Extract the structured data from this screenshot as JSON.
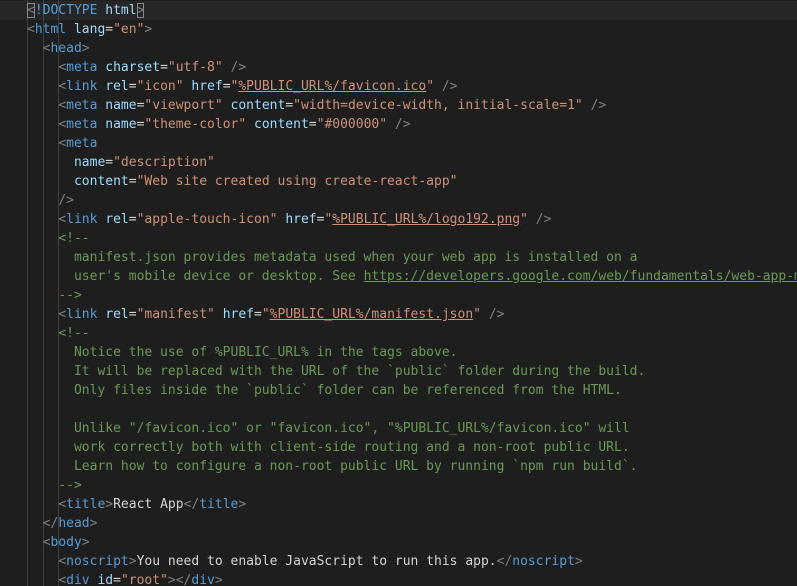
{
  "editor": {
    "colors": {
      "background": "#1e1e1e",
      "tag": "#569cd6",
      "attribute": "#9cdcfe",
      "string": "#ce9178",
      "comment": "#6a9955",
      "punctuation": "#808080",
      "text": "#d4d4d4"
    },
    "lines": [
      {
        "indent": 0,
        "active": true,
        "tokens": [
          {
            "c": "punct",
            "t": "<",
            "bracket": true
          },
          {
            "c": "tag",
            "t": "!DOCTYPE"
          },
          {
            "c": "text",
            "t": " "
          },
          {
            "c": "attr",
            "t": "html"
          },
          {
            "c": "punct",
            "t": ">",
            "bracket": true
          }
        ]
      },
      {
        "indent": 0,
        "tokens": [
          {
            "c": "punct",
            "t": "<"
          },
          {
            "c": "tag",
            "t": "html"
          },
          {
            "c": "text",
            "t": " "
          },
          {
            "c": "attr",
            "t": "lang"
          },
          {
            "c": "text",
            "t": "="
          },
          {
            "c": "str",
            "t": "\"en\""
          },
          {
            "c": "punct",
            "t": ">"
          }
        ]
      },
      {
        "indent": 2,
        "tokens": [
          {
            "c": "punct",
            "t": "<"
          },
          {
            "c": "tag",
            "t": "head"
          },
          {
            "c": "punct",
            "t": ">"
          }
        ]
      },
      {
        "indent": 4,
        "tokens": [
          {
            "c": "punct",
            "t": "<"
          },
          {
            "c": "tag",
            "t": "meta"
          },
          {
            "c": "text",
            "t": " "
          },
          {
            "c": "attr",
            "t": "charset"
          },
          {
            "c": "text",
            "t": "="
          },
          {
            "c": "str",
            "t": "\"utf-8\""
          },
          {
            "c": "text",
            "t": " "
          },
          {
            "c": "punct",
            "t": "/>"
          }
        ]
      },
      {
        "indent": 4,
        "tokens": [
          {
            "c": "punct",
            "t": "<"
          },
          {
            "c": "tag",
            "t": "link"
          },
          {
            "c": "text",
            "t": " "
          },
          {
            "c": "attr",
            "t": "rel"
          },
          {
            "c": "text",
            "t": "="
          },
          {
            "c": "str",
            "t": "\"icon\""
          },
          {
            "c": "text",
            "t": " "
          },
          {
            "c": "attr",
            "t": "href"
          },
          {
            "c": "text",
            "t": "="
          },
          {
            "c": "str",
            "t": "\""
          },
          {
            "c": "str",
            "t": "%PUBLIC_URL%/favicon.ico",
            "link": true
          },
          {
            "c": "str",
            "t": "\""
          },
          {
            "c": "text",
            "t": " "
          },
          {
            "c": "punct",
            "t": "/>"
          }
        ]
      },
      {
        "indent": 4,
        "tokens": [
          {
            "c": "punct",
            "t": "<"
          },
          {
            "c": "tag",
            "t": "meta"
          },
          {
            "c": "text",
            "t": " "
          },
          {
            "c": "attr",
            "t": "name"
          },
          {
            "c": "text",
            "t": "="
          },
          {
            "c": "str",
            "t": "\"viewport\""
          },
          {
            "c": "text",
            "t": " "
          },
          {
            "c": "attr",
            "t": "content"
          },
          {
            "c": "text",
            "t": "="
          },
          {
            "c": "str",
            "t": "\"width=device-width, initial-scale=1\""
          },
          {
            "c": "text",
            "t": " "
          },
          {
            "c": "punct",
            "t": "/>"
          }
        ]
      },
      {
        "indent": 4,
        "tokens": [
          {
            "c": "punct",
            "t": "<"
          },
          {
            "c": "tag",
            "t": "meta"
          },
          {
            "c": "text",
            "t": " "
          },
          {
            "c": "attr",
            "t": "name"
          },
          {
            "c": "text",
            "t": "="
          },
          {
            "c": "str",
            "t": "\"theme-color\""
          },
          {
            "c": "text",
            "t": " "
          },
          {
            "c": "attr",
            "t": "content"
          },
          {
            "c": "text",
            "t": "="
          },
          {
            "c": "str",
            "t": "\"#000000\""
          },
          {
            "c": "text",
            "t": " "
          },
          {
            "c": "punct",
            "t": "/>"
          }
        ]
      },
      {
        "indent": 4,
        "tokens": [
          {
            "c": "punct",
            "t": "<"
          },
          {
            "c": "tag",
            "t": "meta"
          }
        ]
      },
      {
        "indent": 6,
        "tokens": [
          {
            "c": "attr",
            "t": "name"
          },
          {
            "c": "text",
            "t": "="
          },
          {
            "c": "str",
            "t": "\"description\""
          }
        ]
      },
      {
        "indent": 6,
        "tokens": [
          {
            "c": "attr",
            "t": "content"
          },
          {
            "c": "text",
            "t": "="
          },
          {
            "c": "str",
            "t": "\"Web site created using create-react-app\""
          }
        ]
      },
      {
        "indent": 4,
        "tokens": [
          {
            "c": "punct",
            "t": "/>"
          }
        ]
      },
      {
        "indent": 4,
        "tokens": [
          {
            "c": "punct",
            "t": "<"
          },
          {
            "c": "tag",
            "t": "link"
          },
          {
            "c": "text",
            "t": " "
          },
          {
            "c": "attr",
            "t": "rel"
          },
          {
            "c": "text",
            "t": "="
          },
          {
            "c": "str",
            "t": "\"apple-touch-icon\""
          },
          {
            "c": "text",
            "t": " "
          },
          {
            "c": "attr",
            "t": "href"
          },
          {
            "c": "text",
            "t": "="
          },
          {
            "c": "str",
            "t": "\""
          },
          {
            "c": "str",
            "t": "%PUBLIC_URL%/logo192.png",
            "link": true
          },
          {
            "c": "str",
            "t": "\""
          },
          {
            "c": "text",
            "t": " "
          },
          {
            "c": "punct",
            "t": "/>"
          }
        ]
      },
      {
        "indent": 4,
        "tokens": [
          {
            "c": "com",
            "t": "<!--"
          }
        ]
      },
      {
        "indent": 6,
        "tokens": [
          {
            "c": "com",
            "t": "manifest.json provides metadata used when your web app is installed on a"
          }
        ]
      },
      {
        "indent": 6,
        "tokens": [
          {
            "c": "com",
            "t": "user's mobile device or desktop. See "
          },
          {
            "c": "com",
            "t": "https://developers.google.com/web/fundamentals/web-app-ma",
            "link": true
          }
        ]
      },
      {
        "indent": 4,
        "tokens": [
          {
            "c": "com",
            "t": "-->"
          }
        ]
      },
      {
        "indent": 4,
        "tokens": [
          {
            "c": "punct",
            "t": "<"
          },
          {
            "c": "tag",
            "t": "link"
          },
          {
            "c": "text",
            "t": " "
          },
          {
            "c": "attr",
            "t": "rel"
          },
          {
            "c": "text",
            "t": "="
          },
          {
            "c": "str",
            "t": "\"manifest\""
          },
          {
            "c": "text",
            "t": " "
          },
          {
            "c": "attr",
            "t": "href"
          },
          {
            "c": "text",
            "t": "="
          },
          {
            "c": "str",
            "t": "\""
          },
          {
            "c": "str",
            "t": "%PUBLIC_URL%/manifest.json",
            "link": true
          },
          {
            "c": "str",
            "t": "\""
          },
          {
            "c": "text",
            "t": " "
          },
          {
            "c": "punct",
            "t": "/>"
          }
        ]
      },
      {
        "indent": 4,
        "tokens": [
          {
            "c": "com",
            "t": "<!--"
          }
        ]
      },
      {
        "indent": 6,
        "tokens": [
          {
            "c": "com",
            "t": "Notice the use of %PUBLIC_URL% in the tags above."
          }
        ]
      },
      {
        "indent": 6,
        "tokens": [
          {
            "c": "com",
            "t": "It will be replaced with the URL of the `public` folder during the build."
          }
        ]
      },
      {
        "indent": 6,
        "tokens": [
          {
            "c": "com",
            "t": "Only files inside the `public` folder can be referenced from the HTML."
          }
        ]
      },
      {
        "indent": 0,
        "tokens": []
      },
      {
        "indent": 6,
        "tokens": [
          {
            "c": "com",
            "t": "Unlike \"/favicon.ico\" or \"favicon.ico\", \"%PUBLIC_URL%/favicon.ico\" will"
          }
        ]
      },
      {
        "indent": 6,
        "tokens": [
          {
            "c": "com",
            "t": "work correctly both with client-side routing and a non-root public URL."
          }
        ]
      },
      {
        "indent": 6,
        "tokens": [
          {
            "c": "com",
            "t": "Learn how to configure a non-root public URL by running `npm run build`."
          }
        ]
      },
      {
        "indent": 4,
        "tokens": [
          {
            "c": "com",
            "t": "-->"
          }
        ]
      },
      {
        "indent": 4,
        "tokens": [
          {
            "c": "punct",
            "t": "<"
          },
          {
            "c": "tag",
            "t": "title"
          },
          {
            "c": "punct",
            "t": ">"
          },
          {
            "c": "text",
            "t": "React App"
          },
          {
            "c": "punct",
            "t": "</"
          },
          {
            "c": "tag",
            "t": "title"
          },
          {
            "c": "punct",
            "t": ">"
          }
        ]
      },
      {
        "indent": 2,
        "tokens": [
          {
            "c": "punct",
            "t": "</"
          },
          {
            "c": "tag",
            "t": "head"
          },
          {
            "c": "punct",
            "t": ">"
          }
        ]
      },
      {
        "indent": 2,
        "tokens": [
          {
            "c": "punct",
            "t": "<"
          },
          {
            "c": "tag",
            "t": "body"
          },
          {
            "c": "punct",
            "t": ">"
          }
        ]
      },
      {
        "indent": 4,
        "tokens": [
          {
            "c": "punct",
            "t": "<"
          },
          {
            "c": "tag",
            "t": "noscript"
          },
          {
            "c": "punct",
            "t": ">"
          },
          {
            "c": "text",
            "t": "You need to enable JavaScript to run this app."
          },
          {
            "c": "punct",
            "t": "</"
          },
          {
            "c": "tag",
            "t": "noscript"
          },
          {
            "c": "punct",
            "t": ">"
          }
        ]
      },
      {
        "indent": 4,
        "tokens": [
          {
            "c": "punct",
            "t": "<"
          },
          {
            "c": "tag",
            "t": "div"
          },
          {
            "c": "text",
            "t": " "
          },
          {
            "c": "attr",
            "t": "id"
          },
          {
            "c": "text",
            "t": "="
          },
          {
            "c": "str",
            "t": "\"root\""
          },
          {
            "c": "punct",
            "t": "></"
          },
          {
            "c": "tag",
            "t": "div"
          },
          {
            "c": "punct",
            "t": ">"
          }
        ]
      }
    ]
  }
}
